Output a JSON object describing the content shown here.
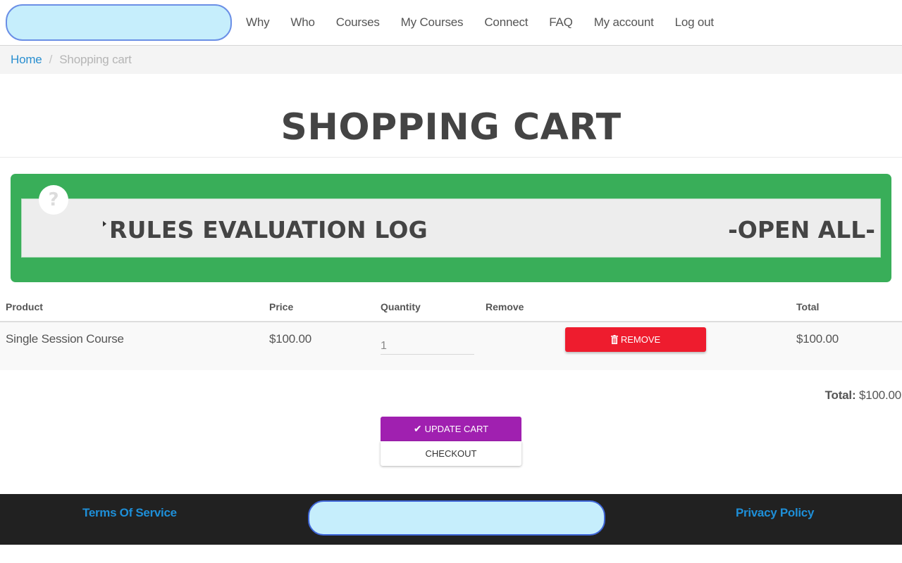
{
  "header": {
    "nav": [
      {
        "label": "Why"
      },
      {
        "label": "Who"
      },
      {
        "label": "Courses"
      },
      {
        "label": "My Courses"
      },
      {
        "label": "Connect"
      },
      {
        "label": "FAQ"
      },
      {
        "label": "My account"
      },
      {
        "label": "Log out"
      }
    ]
  },
  "breadcrumb": {
    "home": "Home",
    "separator": "/",
    "current": "Shopping cart"
  },
  "page": {
    "title": "SHOPPING CART"
  },
  "rules_log": {
    "help_icon": "?",
    "title": "RULES EVALUATION LOG",
    "open_all": "-OPEN ALL-",
    "colors": {
      "panel": "#39ae59",
      "inner": "#ededed"
    }
  },
  "cart": {
    "columns": {
      "product": "Product",
      "price": "Price",
      "quantity": "Quantity",
      "remove": "Remove",
      "total": "Total"
    },
    "rows": [
      {
        "product": "Single Session Course",
        "price": "$100.00",
        "quantity": "1",
        "remove_label": "REMOVE",
        "total": "$100.00"
      }
    ],
    "total_label": "Total:",
    "total_value": "$100.00",
    "update_label": "UPDATE CART",
    "checkout_label": "CHECKOUT",
    "colors": {
      "remove": "#ee1c2e",
      "update": "#a020b0"
    }
  },
  "footer": {
    "terms": "Terms Of Service",
    "privacy": "Privacy Policy"
  }
}
